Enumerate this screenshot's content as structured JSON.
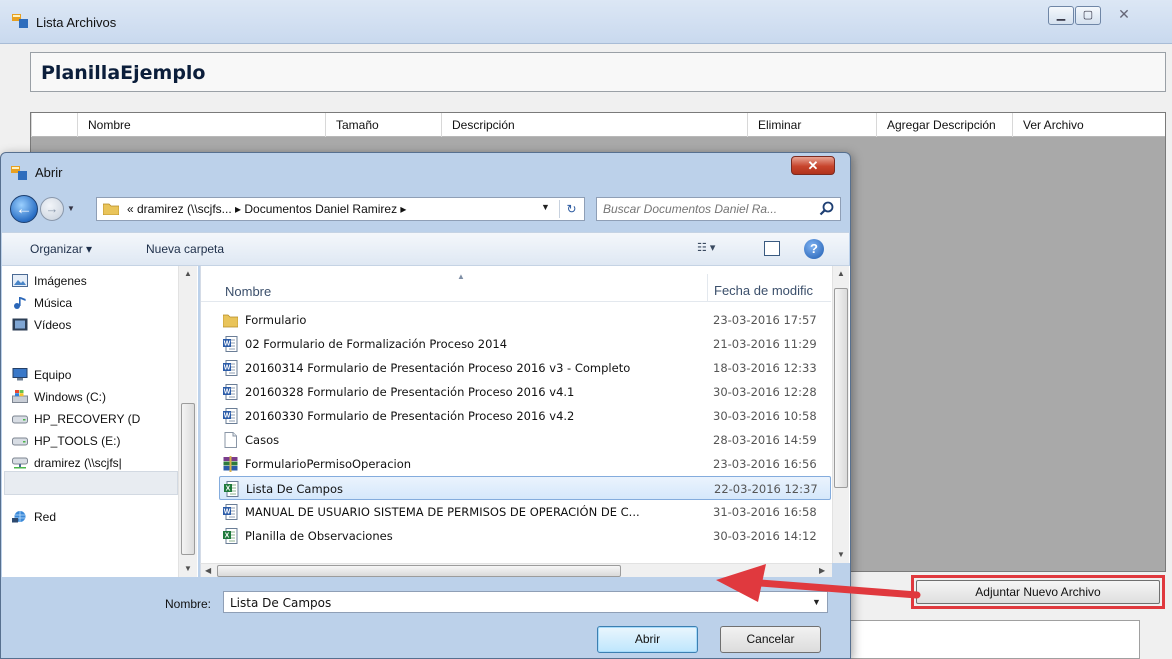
{
  "background_window": {
    "title": "Lista Archivos",
    "header_title": "PlanillaEjemplo",
    "grid_columns": [
      "Nombre",
      "Tamaño",
      "Descripción",
      "Eliminar",
      "Agregar Descripción",
      "Ver Archivo"
    ],
    "attach_button": "Adjuntar Nuevo Archivo"
  },
  "dialog": {
    "title": "Abrir",
    "address_path": "«  dramirez (\\\\scjfs...  ▸  Documentos Daniel Ramirez  ▸",
    "search_placeholder": "Buscar Documentos Daniel Ra...",
    "toolbar": {
      "organize": "Organizar ▾",
      "new_folder": "Nueva carpeta"
    },
    "nav_items": [
      "Imágenes",
      "Música",
      "Vídeos",
      "Equipo",
      "Windows (C:)",
      "HP_RECOVERY (D",
      "HP_TOOLS (E:)",
      "dramirez (\\\\scjfs|",
      "Red"
    ],
    "columns": {
      "name": "Nombre",
      "date": "Fecha de modific"
    },
    "files": [
      {
        "name": "Formulario",
        "date": "23-03-2016 17:57",
        "icon": "folder-icon"
      },
      {
        "name": "02 Formulario de Formalización Proceso 2014",
        "date": "21-03-2016 11:29",
        "icon": "word-doc-icon"
      },
      {
        "name": "20160314 Formulario de Presentación Proceso 2016 v3 - Completo",
        "date": "18-03-2016 12:33",
        "icon": "word-doc-icon"
      },
      {
        "name": "20160328 Formulario de Presentación Proceso 2016 v4.1",
        "date": "30-03-2016 12:28",
        "icon": "word-doc-icon"
      },
      {
        "name": "20160330 Formulario de Presentación Proceso 2016 v4.2",
        "date": "30-03-2016 10:58",
        "icon": "word-doc-icon"
      },
      {
        "name": "Casos",
        "date": "28-03-2016 14:59",
        "icon": "text-file-icon"
      },
      {
        "name": "FormularioPermisoOperacion",
        "date": "23-03-2016 16:56",
        "icon": "archive-icon"
      },
      {
        "name": "Lista De Campos",
        "date": "22-03-2016 12:37",
        "icon": "excel-doc-icon"
      },
      {
        "name": "MANUAL DE USUARIO SISTEMA DE PERMISOS DE OPERACIÓN DE C...",
        "date": "31-03-2016 16:58",
        "icon": "word-doc-icon"
      },
      {
        "name": "Planilla de Observaciones",
        "date": "30-03-2016 14:12",
        "icon": "excel-doc-icon"
      }
    ],
    "selected_file": "Lista De Campos",
    "filename_label": "Nombre:",
    "filename_value": "Lista De Campos",
    "open_button": "Abrir",
    "cancel_button": "Cancelar"
  },
  "colors": {
    "highlight_box": "#e0393e",
    "arrow": "#e0393e",
    "dialog_frame": "#bcd1ea",
    "grid_background": "#a9a9a9"
  }
}
